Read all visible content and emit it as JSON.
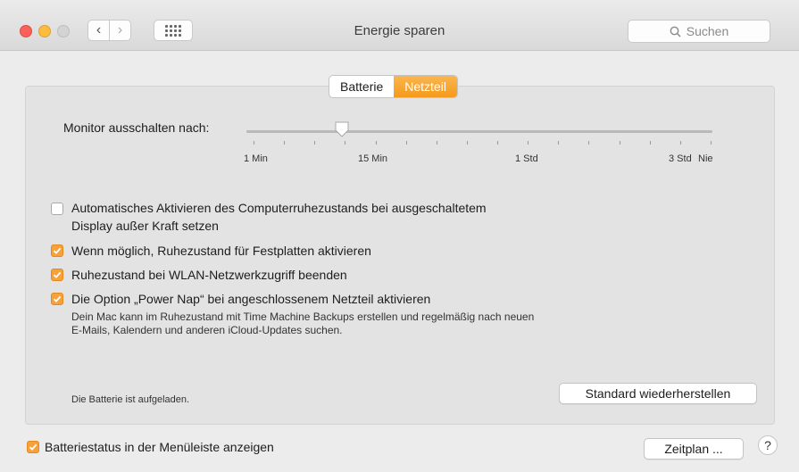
{
  "window": {
    "title": "Energie sparen",
    "search_placeholder": "Suchen",
    "nav": {
      "back_glyph": "‹",
      "forward_glyph": "›"
    }
  },
  "tabs": [
    {
      "label": "Batterie",
      "active": false
    },
    {
      "label": "Netzteil",
      "active": true
    }
  ],
  "monitor": {
    "label": "Monitor ausschalten nach:",
    "ticks": [
      "1 Min",
      "15 Min",
      "1 Std",
      "3 Std",
      "Nie"
    ],
    "value": "15 Min"
  },
  "options": [
    {
      "line1": "Automatisches Aktivieren des Computerruhezustands bei ausgeschaltetem",
      "line2": "Display außer Kraft setzen",
      "checked": false
    },
    {
      "line1": "Wenn möglich, Ruhezustand für Festplatten aktivieren",
      "checked": true
    },
    {
      "line1": "Ruhezustand bei WLAN-Netzwerkzugriff beenden",
      "checked": true
    },
    {
      "line1": "Die Option „Power Nap“ bei angeschlossenem Netzteil aktivieren",
      "checked": true
    }
  ],
  "power_nap_desc": {
    "line1": "Dein Mac kann im Ruhezustand mit Time Machine Backups erstellen und regelmäßig nach neuen",
    "line2": "E-Mails, Kalendern und anderen iCloud-Updates suchen."
  },
  "battery_status": "Die Batterie ist aufgeladen.",
  "restore_button": "Standard wiederherstellen",
  "menubar_option": {
    "label": "Batteriestatus in der Menüleiste anzeigen",
    "checked": true
  },
  "schedule_button": "Zeitplan ...",
  "help_glyph": "?",
  "colors": {
    "accent": "#f7a13a",
    "close": "#fc605b",
    "minimize": "#fdbc40"
  }
}
